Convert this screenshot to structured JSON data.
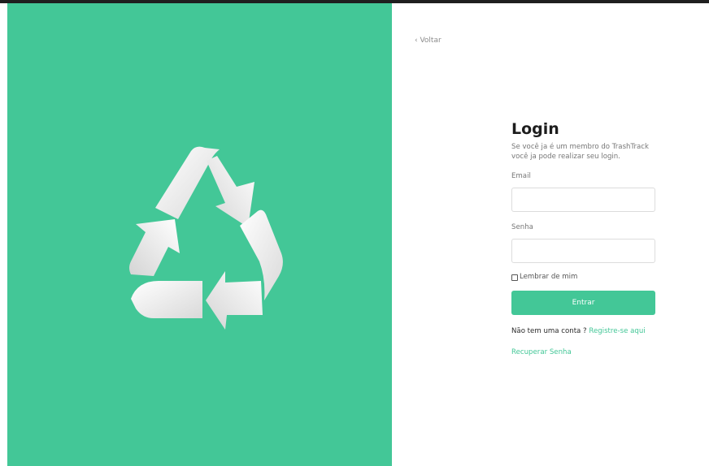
{
  "nav": {
    "back_label": "‹ Voltar"
  },
  "login": {
    "title": "Login",
    "subtitle": "Se você ja é um membro do TrashTrack você ja pode realizar seu login.",
    "email_label": "Email",
    "email_value": "",
    "password_label": "Senha",
    "password_value": "",
    "remember_label": "Lembrar de mim",
    "submit_label": "Entrar",
    "no_account_text": "Não tem uma conta ? ",
    "register_link": "Registre-se aqui",
    "recover_link": "Recuperar Senha"
  },
  "icons": {
    "hero": "recycle-icon"
  },
  "colors": {
    "accent": "#43c797",
    "logo": "#ffffff"
  }
}
